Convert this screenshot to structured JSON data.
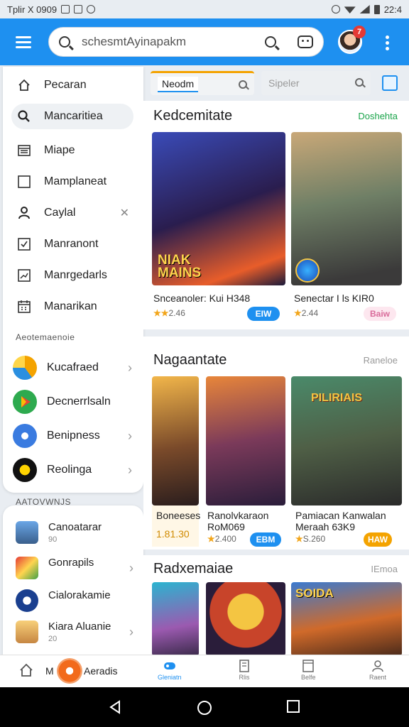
{
  "status_bar": {
    "left_text": "Tplir X 0909",
    "time": "22:4"
  },
  "app_bar": {
    "search_text": "schesmtAyinapakm",
    "notification_count": "7"
  },
  "drawer": {
    "nav_items": [
      {
        "label": "Pecaran",
        "icon": "home-icon"
      },
      {
        "label": "Mancaritiea",
        "icon": "search-icon"
      },
      {
        "label": "Miape",
        "icon": "list-icon"
      },
      {
        "label": "Mamplaneat",
        "icon": "square-icon"
      },
      {
        "label": "Caylal",
        "icon": "person-icon"
      },
      {
        "label": "Manranont",
        "icon": "checkbox-icon"
      },
      {
        "label": "Manrgedarls",
        "icon": "chart-icon"
      },
      {
        "label": "Manarikan",
        "icon": "calendar-icon"
      }
    ],
    "section_heading": "Aeotemaenoie",
    "app_items": [
      {
        "label": "Kucafraed",
        "color": "#f4a300"
      },
      {
        "label": "Decnerrlsaln",
        "color": "#2eaa4f"
      },
      {
        "label": "Benipness",
        "color": "#3a7be0"
      },
      {
        "label": "Reolinga",
        "color": "#111111"
      }
    ],
    "section2_heading": "AATOVWNJS",
    "mini_items": [
      {
        "title": "Canoatarar",
        "sub": "90"
      },
      {
        "title": "Gonrapils",
        "sub": ""
      },
      {
        "title": "Cialorakamie",
        "sub": ""
      },
      {
        "title": "Kiara Aluanie",
        "sub": "20"
      }
    ]
  },
  "filters": {
    "tab1": "Neodm",
    "tab2": "Sipeler"
  },
  "sections": [
    {
      "title": "Kedcemitate",
      "link": "Doshehta",
      "games": [
        {
          "name": "Snceanoler: Kui H348",
          "rating": "2.46",
          "button": "EIW",
          "art_text": "NIAK MAINS"
        },
        {
          "name": "Senectar I ls KIR0",
          "rating": "2.44",
          "button": "Baiw",
          "art_text": ""
        }
      ]
    },
    {
      "title": "Nagaantate",
      "link": "Raneloe",
      "games": [
        {
          "name": "Boneeses",
          "rating": "1.81.30",
          "button": "",
          "art_text": ""
        },
        {
          "name": "Ranolvkaraon RoM069",
          "rating": "2.400",
          "button": "EBM",
          "art_text": ""
        },
        {
          "name": "Pamiacan Kanwalan Meraah 63K9",
          "rating": "S.260",
          "button": "HAW",
          "art_text": "PILIRIAIS"
        }
      ]
    },
    {
      "title": "Radxemaiae",
      "link": "IEmoa",
      "games": [
        {
          "name": "",
          "art_text": ""
        },
        {
          "name": "",
          "art_text": ""
        },
        {
          "name": "",
          "art_text": "SOIDA"
        }
      ]
    }
  ],
  "bottom_nav": {
    "left_label": "M",
    "left_label2": "Aeradis",
    "tabs": [
      {
        "label": "Gleniatn"
      },
      {
        "label": "Rlis"
      },
      {
        "label": "Belfe"
      },
      {
        "label": "Raent"
      }
    ]
  },
  "colors": {
    "accent": "#1e90f0",
    "link_green": "#1aa44a",
    "star": "#f2a51a"
  }
}
